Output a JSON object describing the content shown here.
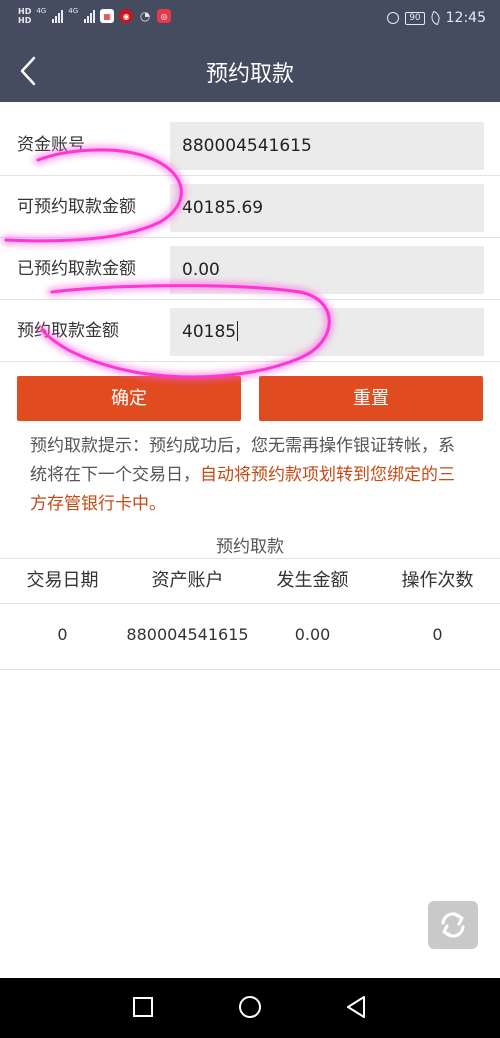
{
  "status_bar": {
    "network_left_top": "HD",
    "network_left_bottom": "HD",
    "network_type_1": "4G",
    "network_type_2": "4G",
    "battery_level": "90",
    "time": "12:45",
    "icons": [
      "signal-icon",
      "app-notification-icon",
      "wechat-icon",
      "message-icon",
      "alarm-icon",
      "battery-icon",
      "eco-leaf-icon"
    ]
  },
  "header": {
    "title": "预约取款",
    "back_icon": "chevron-left-icon"
  },
  "form": {
    "fields": [
      {
        "label": "资金账号",
        "value": "880004541615"
      },
      {
        "label": "可预约取款金额",
        "value": "40185.69"
      },
      {
        "label": "已预约取款金额",
        "value": "0.00"
      },
      {
        "label": "预约取款金额",
        "value": "40185"
      }
    ]
  },
  "buttons": {
    "confirm": "确定",
    "reset": "重置"
  },
  "tip": {
    "normal": "预约取款提示：预约成功后，您无需再操作银证转帐，系统将在下一个交易日，",
    "highlight": "自动将预约款项划转到您绑定的三方存管银行卡中。",
    "highlight_color": "#c64a14"
  },
  "history": {
    "title": "预约取款",
    "columns": [
      "交易日期",
      "资产账户",
      "发生金额",
      "操作次数"
    ],
    "rows": [
      [
        "0",
        "880004541615",
        "0.00",
        "0"
      ]
    ]
  },
  "colors": {
    "header_bg": "#454c60",
    "button_bg": "#e04b1f",
    "field_bg": "#ebebeb",
    "annotation_stroke": "#ff3fd0"
  },
  "floating_refresh_icon": "refresh-icon",
  "navigation": {
    "icons": [
      "recent-apps-icon",
      "home-icon",
      "back-triangle-icon"
    ]
  }
}
